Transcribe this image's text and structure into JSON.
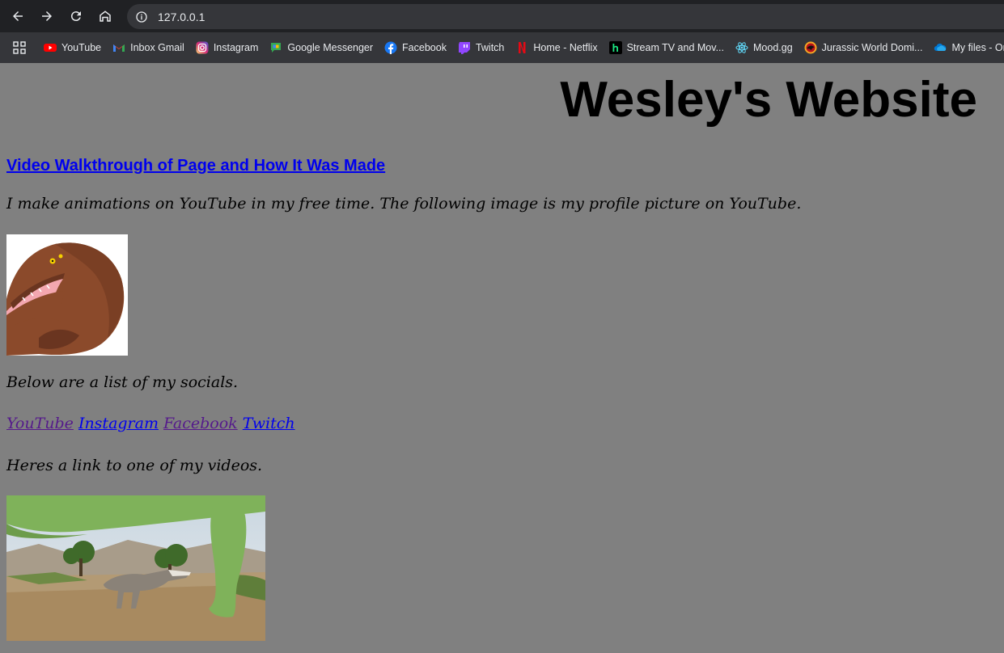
{
  "browser": {
    "url": "127.0.0.1",
    "bookmarks": [
      {
        "label": "YouTube",
        "icon": "youtube-icon",
        "color": "#ff0000"
      },
      {
        "label": "Inbox Gmail",
        "icon": "gmail-icon",
        "color": "#ea4335"
      },
      {
        "label": "Instagram",
        "icon": "instagram-icon",
        "color": "#e1306c"
      },
      {
        "label": "Google Messenger",
        "icon": "messages-icon",
        "color": "#34a853"
      },
      {
        "label": "Facebook",
        "icon": "facebook-icon",
        "color": "#1877f2"
      },
      {
        "label": "Twitch",
        "icon": "twitch-icon",
        "color": "#9146ff"
      },
      {
        "label": "Home - Netflix",
        "icon": "netflix-icon",
        "color": "#e50914"
      },
      {
        "label": "Stream TV and Mov...",
        "icon": "hulu-icon",
        "color": "#1ce783"
      },
      {
        "label": "Mood.gg",
        "icon": "react-icon",
        "color": "#61dafb"
      },
      {
        "label": "Jurassic World Domi...",
        "icon": "jurassic-icon",
        "color": "#f5a623"
      },
      {
        "label": "My files - On",
        "icon": "onedrive-icon",
        "color": "#0078d4"
      }
    ]
  },
  "page": {
    "title": "Wesley's Website",
    "walkthrough_link": "Video Walkthrough of Page and How It Was Made",
    "intro": "I make animations on YouTube in my free time. The following image is my profile picture on YouTube.",
    "socials_intro": "Below are a list of my socials.",
    "socials": [
      {
        "label": "YouTube",
        "visited": true
      },
      {
        "label": "Instagram",
        "visited": false
      },
      {
        "label": "Facebook",
        "visited": true
      },
      {
        "label": "Twitch",
        "visited": false
      }
    ],
    "video_intro": "Heres a link to one of my videos."
  }
}
